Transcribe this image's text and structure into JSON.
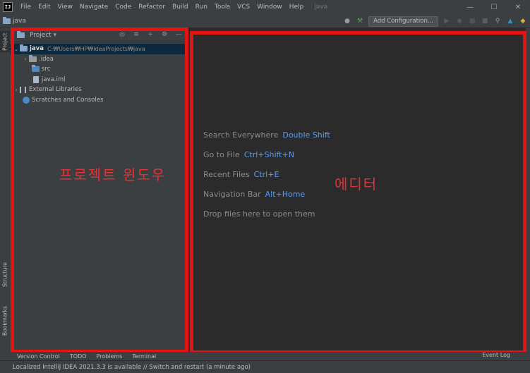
{
  "app": {
    "logo": "IJ",
    "menu": [
      "File",
      "Edit",
      "View",
      "Navigate",
      "Code",
      "Refactor",
      "Build",
      "Run",
      "Tools",
      "VCS",
      "Window",
      "Help"
    ],
    "window_title": "java"
  },
  "navbar": {
    "project_name": "java",
    "add_config_label": "Add Configuration..."
  },
  "left_strip": {
    "project_tab": "Project",
    "structure_tab": "Structure",
    "bookmarks_tab": "Bookmarks"
  },
  "project_panel": {
    "title": "Project",
    "tree": {
      "root_name": "java",
      "root_path": "C:₩Users₩HP₩IdeaProjects₩java",
      "idea": ".idea",
      "src": "src",
      "iml": "java.iml",
      "external": "External Libraries",
      "scratches": "Scratches and Consoles"
    },
    "annotation": "프로젝트 윈도우"
  },
  "editor": {
    "hints": [
      {
        "label": "Search Everywhere",
        "key": "Double Shift"
      },
      {
        "label": "Go to File",
        "key": "Ctrl+Shift+N"
      },
      {
        "label": "Recent Files",
        "key": "Ctrl+E"
      },
      {
        "label": "Navigation Bar",
        "key": "Alt+Home"
      },
      {
        "label": "Drop files here to open them",
        "key": ""
      }
    ],
    "annotation": "에디터"
  },
  "bottom_tabs": {
    "version_control": "Version Control",
    "todo": "TODO",
    "problems": "Problems",
    "terminal": "Terminal",
    "event_log": "Event Log"
  },
  "status": {
    "message": "Localized IntelliJ IDEA 2021.3.3 is available // Switch and restart (a minute ago)"
  },
  "colors": {
    "highlight": "#e41414",
    "annotation_text": "#e53333",
    "shortcut_blue": "#589df6"
  }
}
